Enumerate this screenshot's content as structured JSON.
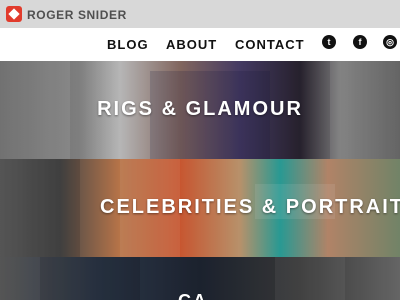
{
  "header": {
    "brand": "ROGER SNIDER"
  },
  "nav": {
    "items": [
      "BLOG",
      "ABOUT",
      "CONTACT"
    ],
    "social": [
      {
        "icon": "twitter-icon",
        "glyph": "t"
      },
      {
        "icon": "facebook-icon",
        "glyph": "f"
      },
      {
        "icon": "instagram-icon",
        "glyph": "◎"
      }
    ]
  },
  "sections": [
    {
      "title": "RIGS & GLAMOUR"
    },
    {
      "title": "CELEBRITIES & PORTRAITS"
    },
    {
      "title": "CA.."
    }
  ],
  "colors": {
    "logo_red": "#e13b2c",
    "nav_text": "#111111",
    "topbar_bg": "#d8d8d8"
  }
}
